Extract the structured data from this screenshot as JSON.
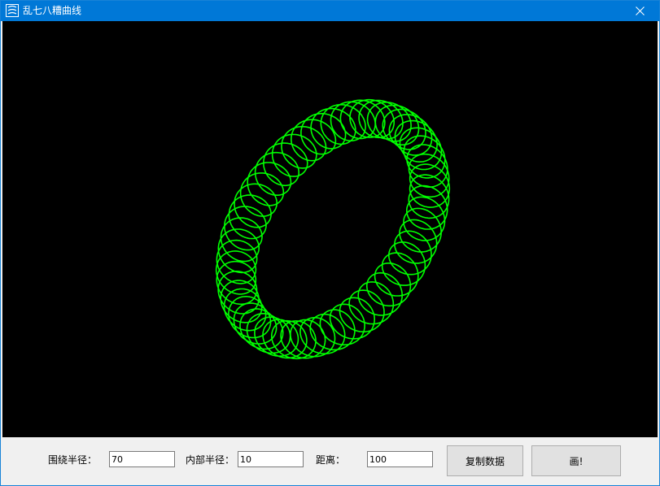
{
  "window": {
    "title": "乱七八糟曲线",
    "icon": "app-icon",
    "close_icon": "close-icon"
  },
  "colors": {
    "titlebar": "#0078d7",
    "canvas_background": "#000000",
    "curve": "#00ff00",
    "panel": "#f0f0f0"
  },
  "form": {
    "outer_radius_label": "围绕半径：",
    "outer_radius_value": "70",
    "inner_radius_label": "内部半径：",
    "inner_radius_value": "10",
    "distance_label": "距离：",
    "distance_value": "100"
  },
  "buttons": {
    "copy_label": "复制数据",
    "draw_label": "画!"
  }
}
